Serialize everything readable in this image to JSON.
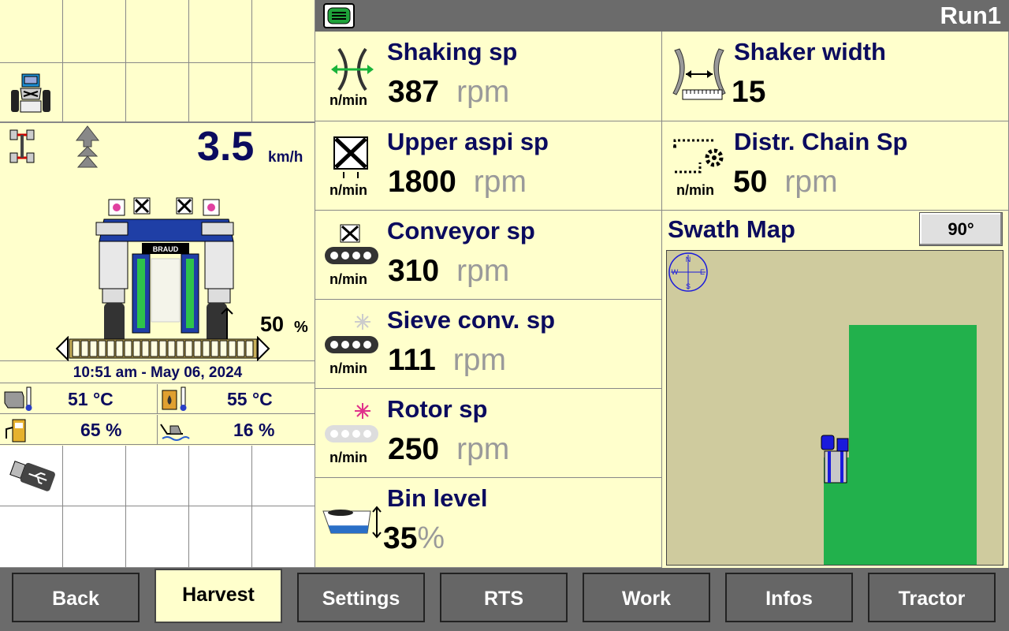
{
  "header": {
    "title": "Run1",
    "menu_icon": "menu-icon"
  },
  "left": {
    "speed": {
      "value": "3.5",
      "unit": "km/h"
    },
    "lift": {
      "value": "50",
      "unit": "%"
    },
    "datetime": "10:51 am - May 06, 2024",
    "sensors": {
      "engine_temp": "51 °C",
      "hydraulic_temp": "55 °C",
      "fuel": "65 %",
      "water": "16 %"
    }
  },
  "tiles": {
    "shaking": {
      "label": "Shaking sp",
      "value": "387",
      "unit": "rpm",
      "per": "n/min"
    },
    "upper_aspi": {
      "label": "Upper aspi sp",
      "value": "1800",
      "unit": "rpm",
      "per": "n/min"
    },
    "conveyor": {
      "label": "Conveyor sp",
      "value": "310",
      "unit": "rpm",
      "per": "n/min"
    },
    "sieve": {
      "label": "Sieve conv. sp",
      "value": "111",
      "unit": "rpm",
      "per": "n/min"
    },
    "rotor": {
      "label": "Rotor sp",
      "value": "250",
      "unit": "rpm",
      "per": "n/min"
    },
    "bin": {
      "label": "Bin level",
      "value": "35",
      "unit": "%",
      "level": 0.35
    },
    "shaker_width": {
      "label": "Shaker width",
      "value": "15"
    },
    "chain": {
      "label": "Distr. Chain Sp",
      "value": "50",
      "unit": "rpm",
      "per": "n/min"
    }
  },
  "swath": {
    "title": "Swath Map",
    "angle_button": "90°",
    "compass": {
      "n": "N",
      "e": "E",
      "s": "S",
      "w": "W"
    },
    "colors": {
      "field": "#cfcb9e",
      "harvested": "#22b14c",
      "machine": "#1a1adc"
    }
  },
  "nav": {
    "back": "Back",
    "harvest": "Harvest",
    "settings": "Settings",
    "rts": "RTS",
    "work": "Work",
    "infos": "Infos",
    "tractor": "Tractor"
  }
}
